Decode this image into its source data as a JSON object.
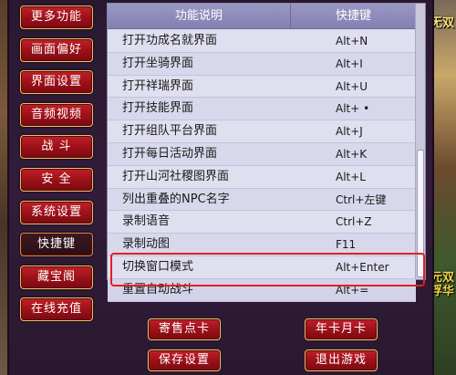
{
  "side_menu": [
    {
      "label": "更多功能",
      "active": false
    },
    {
      "label": "画面偏好",
      "active": false
    },
    {
      "label": "界面设置",
      "active": false
    },
    {
      "label": "音频视频",
      "active": false
    },
    {
      "label": "战 斗",
      "active": false
    },
    {
      "label": "安 全",
      "active": false
    },
    {
      "label": "系统设置",
      "active": false
    },
    {
      "label": "快捷键",
      "active": true
    },
    {
      "label": "藏宝阁",
      "active": false
    },
    {
      "label": "在线充值",
      "active": false
    }
  ],
  "table": {
    "headers": {
      "description": "功能说明",
      "shortcut": "快捷键"
    },
    "rows": [
      {
        "description": "打开功成名就界面",
        "shortcut": "Alt+N"
      },
      {
        "description": "打开坐骑界面",
        "shortcut": "Alt+I"
      },
      {
        "description": "打开祥瑞界面",
        "shortcut": "Alt+U"
      },
      {
        "description": "打开技能界面",
        "shortcut": "Alt+ •"
      },
      {
        "description": "打开组队平台界面",
        "shortcut": "Alt+J"
      },
      {
        "description": "打开每日活动界面",
        "shortcut": "Alt+K"
      },
      {
        "description": "打开山河社稷图界面",
        "shortcut": "Alt+L"
      },
      {
        "description": "列出重叠的NPC名字",
        "shortcut": "Ctrl+左键"
      },
      {
        "description": "录制语音",
        "shortcut": "Ctrl+Z"
      },
      {
        "description": "录制动图",
        "shortcut": "F11"
      },
      {
        "description": "切换窗口模式",
        "shortcut": "Alt+Enter"
      },
      {
        "description": "重置自动战斗",
        "shortcut": "Alt+="
      }
    ]
  },
  "bottom_buttons": {
    "sell_card": "寄售点卡",
    "annual_card": "年卡月卡",
    "save_settings": "保存设置",
    "exit_game": "退出游戏"
  },
  "background_text": {
    "top_right": "无双",
    "mid_right_1": "元双",
    "mid_right_2": "浮华"
  },
  "colors": {
    "button_red": "#9a1018",
    "button_border": "#f0c060",
    "table_header": "#8a88ba",
    "table_bg": "#dcdcee",
    "highlight": "#e02020"
  }
}
